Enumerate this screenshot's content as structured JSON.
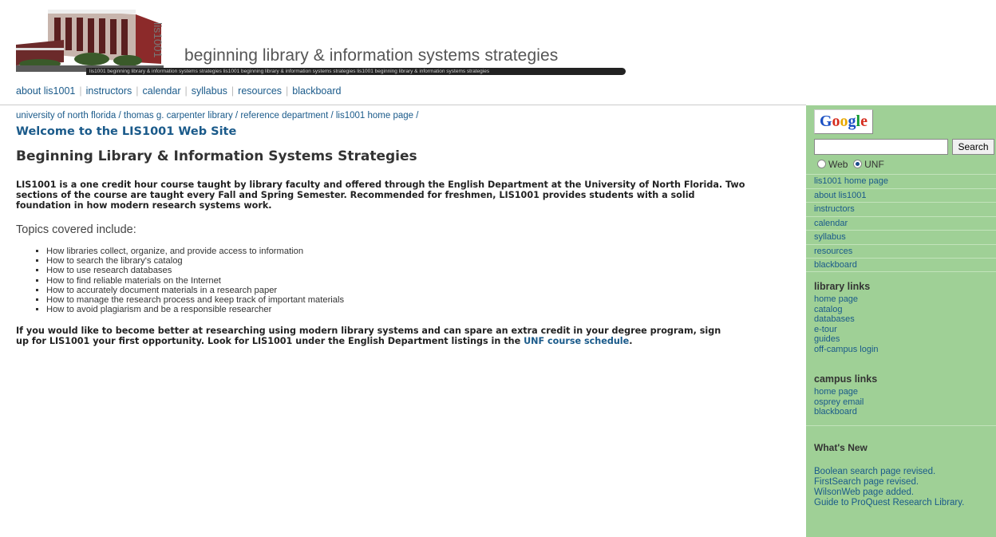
{
  "header": {
    "vertical_label": "lis1001",
    "title": "beginning library & information systems strategies",
    "ribbon_text": "lis1001 beginning library & information systems strategies lis1001 beginning library & information systems strategies lis1001 beginning library & information systems strategies"
  },
  "topnav": {
    "items": [
      "about lis1001",
      "instructors",
      "calendar",
      "syllabus",
      "resources",
      "blackboard"
    ],
    "separator": "|"
  },
  "breadcrumb": {
    "items": [
      "university of north florida",
      "thomas g. carpenter library",
      "reference department",
      "lis1001 home page"
    ],
    "separator": "/"
  },
  "main": {
    "welcome": "Welcome to the LIS1001 Web Site",
    "heading": "Beginning Library & Information Systems Strategies",
    "intro": "LIS1001 is a one credit hour course taught by library faculty and offered through the English Department at the University of North Florida. Two sections of the course are taught every Fall and Spring Semester. Recommended for freshmen, LIS1001 provides students with a solid foundation in how modern research systems work.",
    "topics_label": "Topics covered include:",
    "topics": [
      "How libraries collect, organize, and provide access to information",
      "How to search the library's catalog",
      "How to use research databases",
      "How to find reliable materials on the Internet",
      "How to accurately document materials in a research paper",
      "How to manage the research process and keep track of important materials",
      "How to avoid plagiarism and be a responsible researcher"
    ],
    "closing_text": "If you would like to become better at researching using modern library systems and can spare an extra credit in your degree program, sign up for LIS1001 your first opportunity. Look for LIS1001 under the English Department listings in the",
    "closing_link": "UNF course schedule",
    "closing_end": "."
  },
  "sidebar": {
    "google": {
      "letters": [
        "G",
        "o",
        "o",
        "g",
        "l",
        "e"
      ],
      "letter_colors": [
        "#1a4fc4",
        "#d62d20",
        "#e8a800",
        "#1a4fc4",
        "#109a30",
        "#d62d20"
      ],
      "search_value": "",
      "search_button": "Search",
      "radio_web": "Web",
      "radio_unf": "UNF",
      "selected": "UNF"
    },
    "nav": [
      "lis1001 home page",
      "about lis1001",
      "instructors",
      "calendar",
      "syllabus",
      "resources",
      "blackboard"
    ],
    "library_links": {
      "heading": "library links",
      "items": [
        "home page",
        "catalog",
        "databases",
        "e-tour",
        "guides",
        "off-campus login"
      ]
    },
    "campus_links": {
      "heading": "campus links",
      "items": [
        "home page",
        "osprey email",
        "blackboard"
      ]
    },
    "whats_new": {
      "heading": "What's New",
      "items": [
        "Boolean search page revised.",
        "FirstSearch page revised.",
        "WilsonWeb page added.",
        "Guide to ProQuest Research Library."
      ]
    }
  },
  "colors": {
    "link": "#1a5a8a",
    "sidebar_bg": "#9fd096"
  }
}
